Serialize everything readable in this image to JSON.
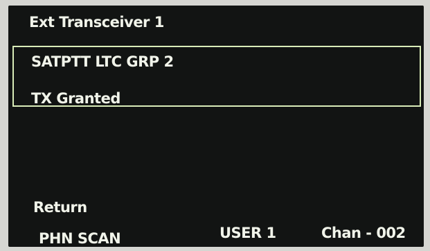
{
  "header": {
    "title": "Ext Transceiver 1"
  },
  "selection": {
    "group_name": "SATPTT LTC GRP 2",
    "status": "TX Granted"
  },
  "menu": {
    "return_label": "Return"
  },
  "footer": {
    "scan_mode": "PHN SCAN",
    "user": "USER 1",
    "channel": "Chan -  002"
  },
  "colors": {
    "screen_background": "#121413",
    "text": "#f1f4ea",
    "selection_border": "#d9ecb8"
  }
}
